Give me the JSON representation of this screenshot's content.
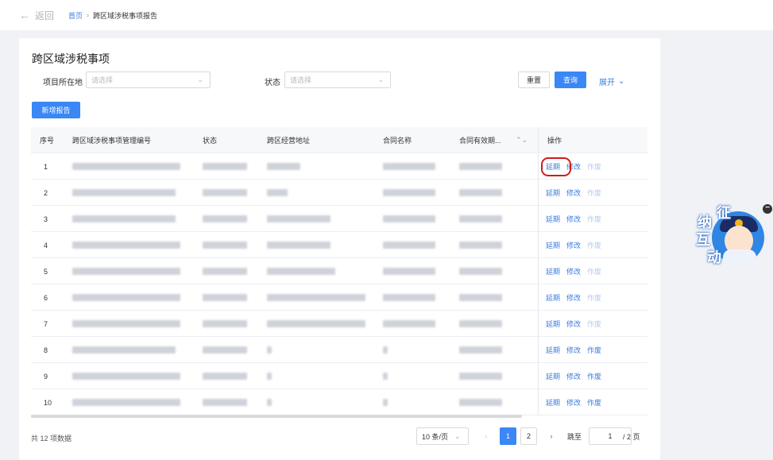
{
  "topbar": {
    "back_label": "返回",
    "breadcrumb_home": "首页",
    "breadcrumb_sep": "›",
    "breadcrumb_current": "跨区域涉税事项报告"
  },
  "page_title": "跨区域涉税事项",
  "filters": {
    "location_label": "项目所在地",
    "location_placeholder": "请选择",
    "status_label": "状态",
    "status_placeholder": "请选择"
  },
  "buttons": {
    "reset": "重置",
    "search": "查询",
    "expand": "展开",
    "new_report": "新增报告"
  },
  "table": {
    "headers": [
      "序号",
      "跨区域涉税事项管理编号",
      "状态",
      "跨区经营地址",
      "合同名称",
      "合同有效期...",
      "操作"
    ],
    "rows": [
      {
        "index": "1",
        "ops": [
          "延期",
          "修改",
          "作废"
        ],
        "void_active": false
      },
      {
        "index": "2",
        "ops": [
          "延期",
          "修改",
          "作废"
        ],
        "void_active": false
      },
      {
        "index": "3",
        "ops": [
          "延期",
          "修改",
          "作废"
        ],
        "void_active": false
      },
      {
        "index": "4",
        "ops": [
          "延期",
          "修改",
          "作废"
        ],
        "void_active": false
      },
      {
        "index": "5",
        "ops": [
          "延期",
          "修改",
          "作废"
        ],
        "void_active": false
      },
      {
        "index": "6",
        "ops": [
          "延期",
          "修改",
          "作废"
        ],
        "void_active": false
      },
      {
        "index": "7",
        "ops": [
          "延期",
          "修改",
          "作废"
        ],
        "void_active": false
      },
      {
        "index": "8",
        "ops": [
          "延期",
          "修改",
          "作废"
        ],
        "void_active": true
      },
      {
        "index": "9",
        "ops": [
          "延期",
          "修改",
          "作废"
        ],
        "void_active": true
      },
      {
        "index": "10",
        "ops": [
          "延期",
          "修改",
          "作废"
        ],
        "void_active": true
      }
    ]
  },
  "footer": {
    "total": "共 12 项数据",
    "page_size": "10 条/页",
    "pages": [
      "1",
      "2"
    ],
    "current_page": "1",
    "jump_label": "跳至",
    "jump_value": "1",
    "page_count": "/ 2 页"
  },
  "widget": {
    "chars": [
      "征",
      "纳",
      "互",
      "动"
    ],
    "minus": "−"
  },
  "colors": {
    "primary": "#3a87f5",
    "link": "#3a7be0",
    "highlight_ring": "#d11b1b"
  }
}
